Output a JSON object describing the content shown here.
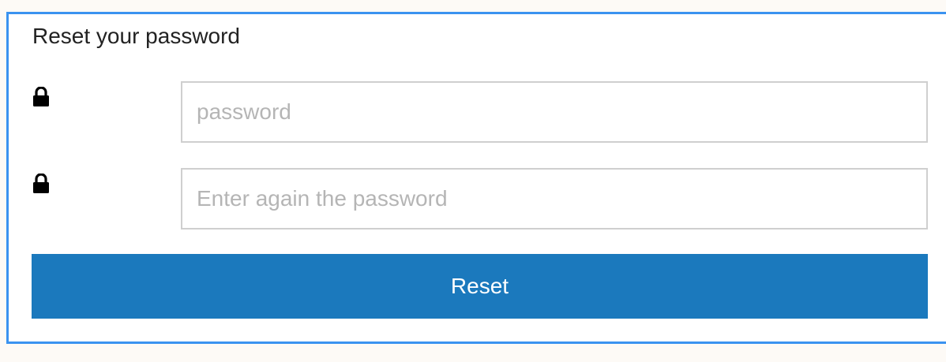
{
  "form": {
    "title": "Reset your password",
    "fields": [
      {
        "icon": "lock-icon",
        "value": "",
        "placeholder": "password"
      },
      {
        "icon": "lock-icon",
        "value": "",
        "placeholder": "Enter again the password"
      }
    ],
    "submit_label": "Reset"
  },
  "colors": {
    "panel_border": "#3b93f0",
    "button_bg": "#1b79bd",
    "button_text": "#ffffff",
    "placeholder_text": "#b5b5b5",
    "field_border": "#cfcfcf"
  }
}
